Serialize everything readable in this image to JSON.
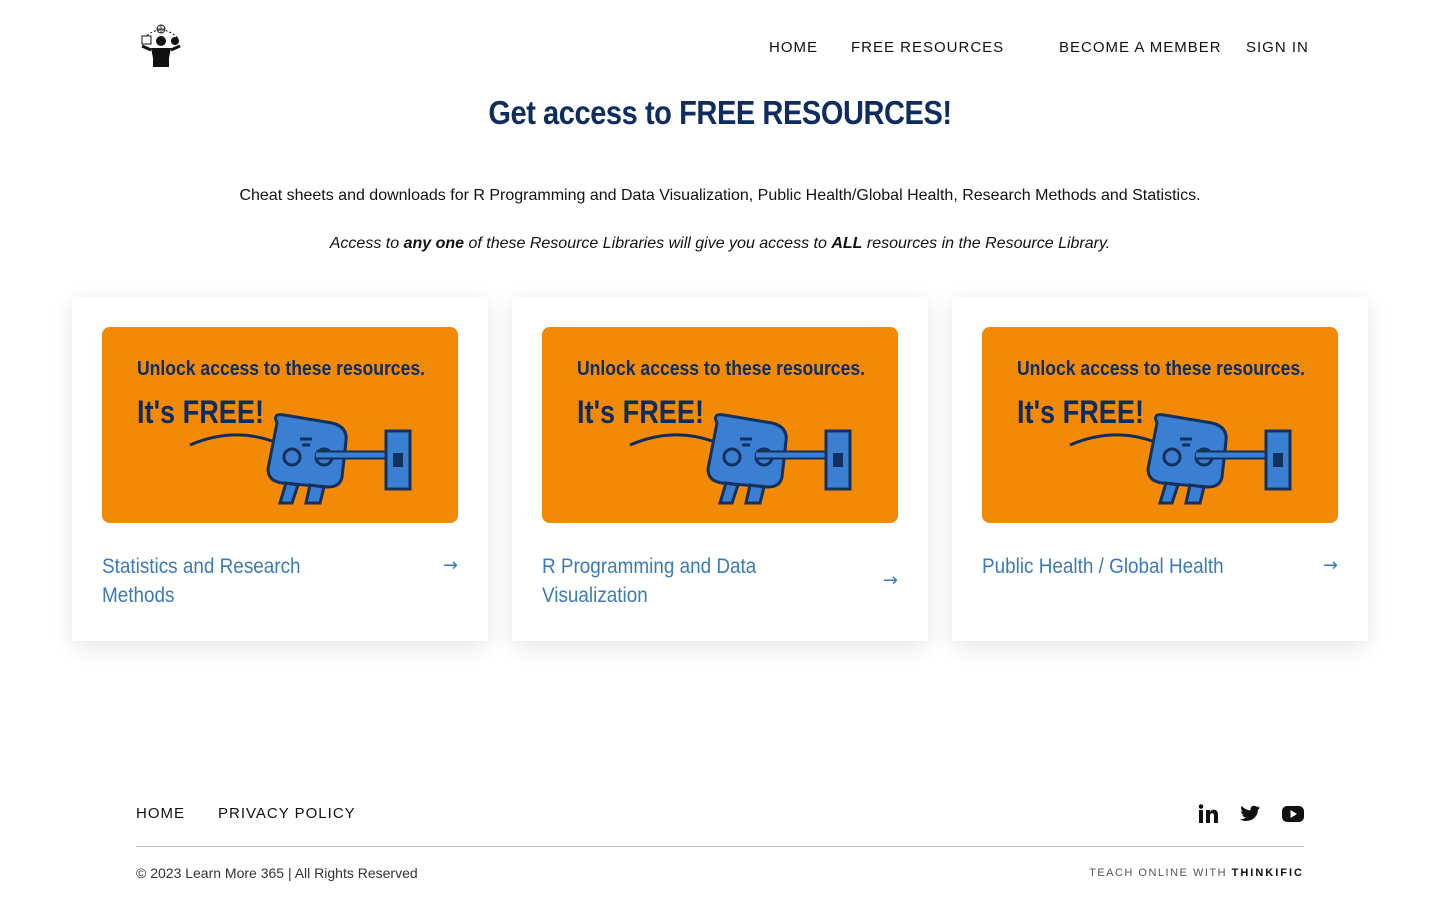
{
  "header": {
    "nav": {
      "home": "HOME",
      "free_resources": "FREE RESOURCES",
      "become_member": "BECOME A MEMBER",
      "sign_in": "SIGN IN"
    }
  },
  "main": {
    "title": "Get access to FREE RESOURCES!",
    "intro": "Cheat sheets and downloads for R Programming and Data Visualization, Public Health/Global Health, Research Methods and Statistics.",
    "access_note": {
      "part1": "Access to ",
      "bold1": "any one",
      "part2": " of these Resource Libraries will give you access to ",
      "bold2": "ALL",
      "part3": " resources in the Resource Library."
    },
    "card_image": {
      "line1": "Unlock access to these resources.",
      "line2": "It's FREE!",
      "bg_color": "#f28a06",
      "text_color": "#0e2c5f",
      "mascot_color": "#3a7fd1"
    },
    "cards": [
      {
        "title": "Statistics and Research Methods",
        "arrow": "→"
      },
      {
        "title": "R Programming and Data Visualization",
        "arrow": "→"
      },
      {
        "title": "Public Health / Global Health",
        "arrow": "→"
      }
    ]
  },
  "footer": {
    "links": {
      "home": "HOME",
      "privacy": "PRIVACY POLICY"
    },
    "social": [
      "linkedin-icon",
      "twitter-icon",
      "youtube-icon"
    ],
    "copyright": "© 2023 Learn More 365 | All Rights Reserved",
    "powered_prefix": "TEACH ONLINE WITH",
    "powered_brand": "THINKIFIC"
  },
  "colors": {
    "title": "#0e2c5f",
    "card_link": "#3a7ab8",
    "card_image_bg": "#f28a06"
  }
}
